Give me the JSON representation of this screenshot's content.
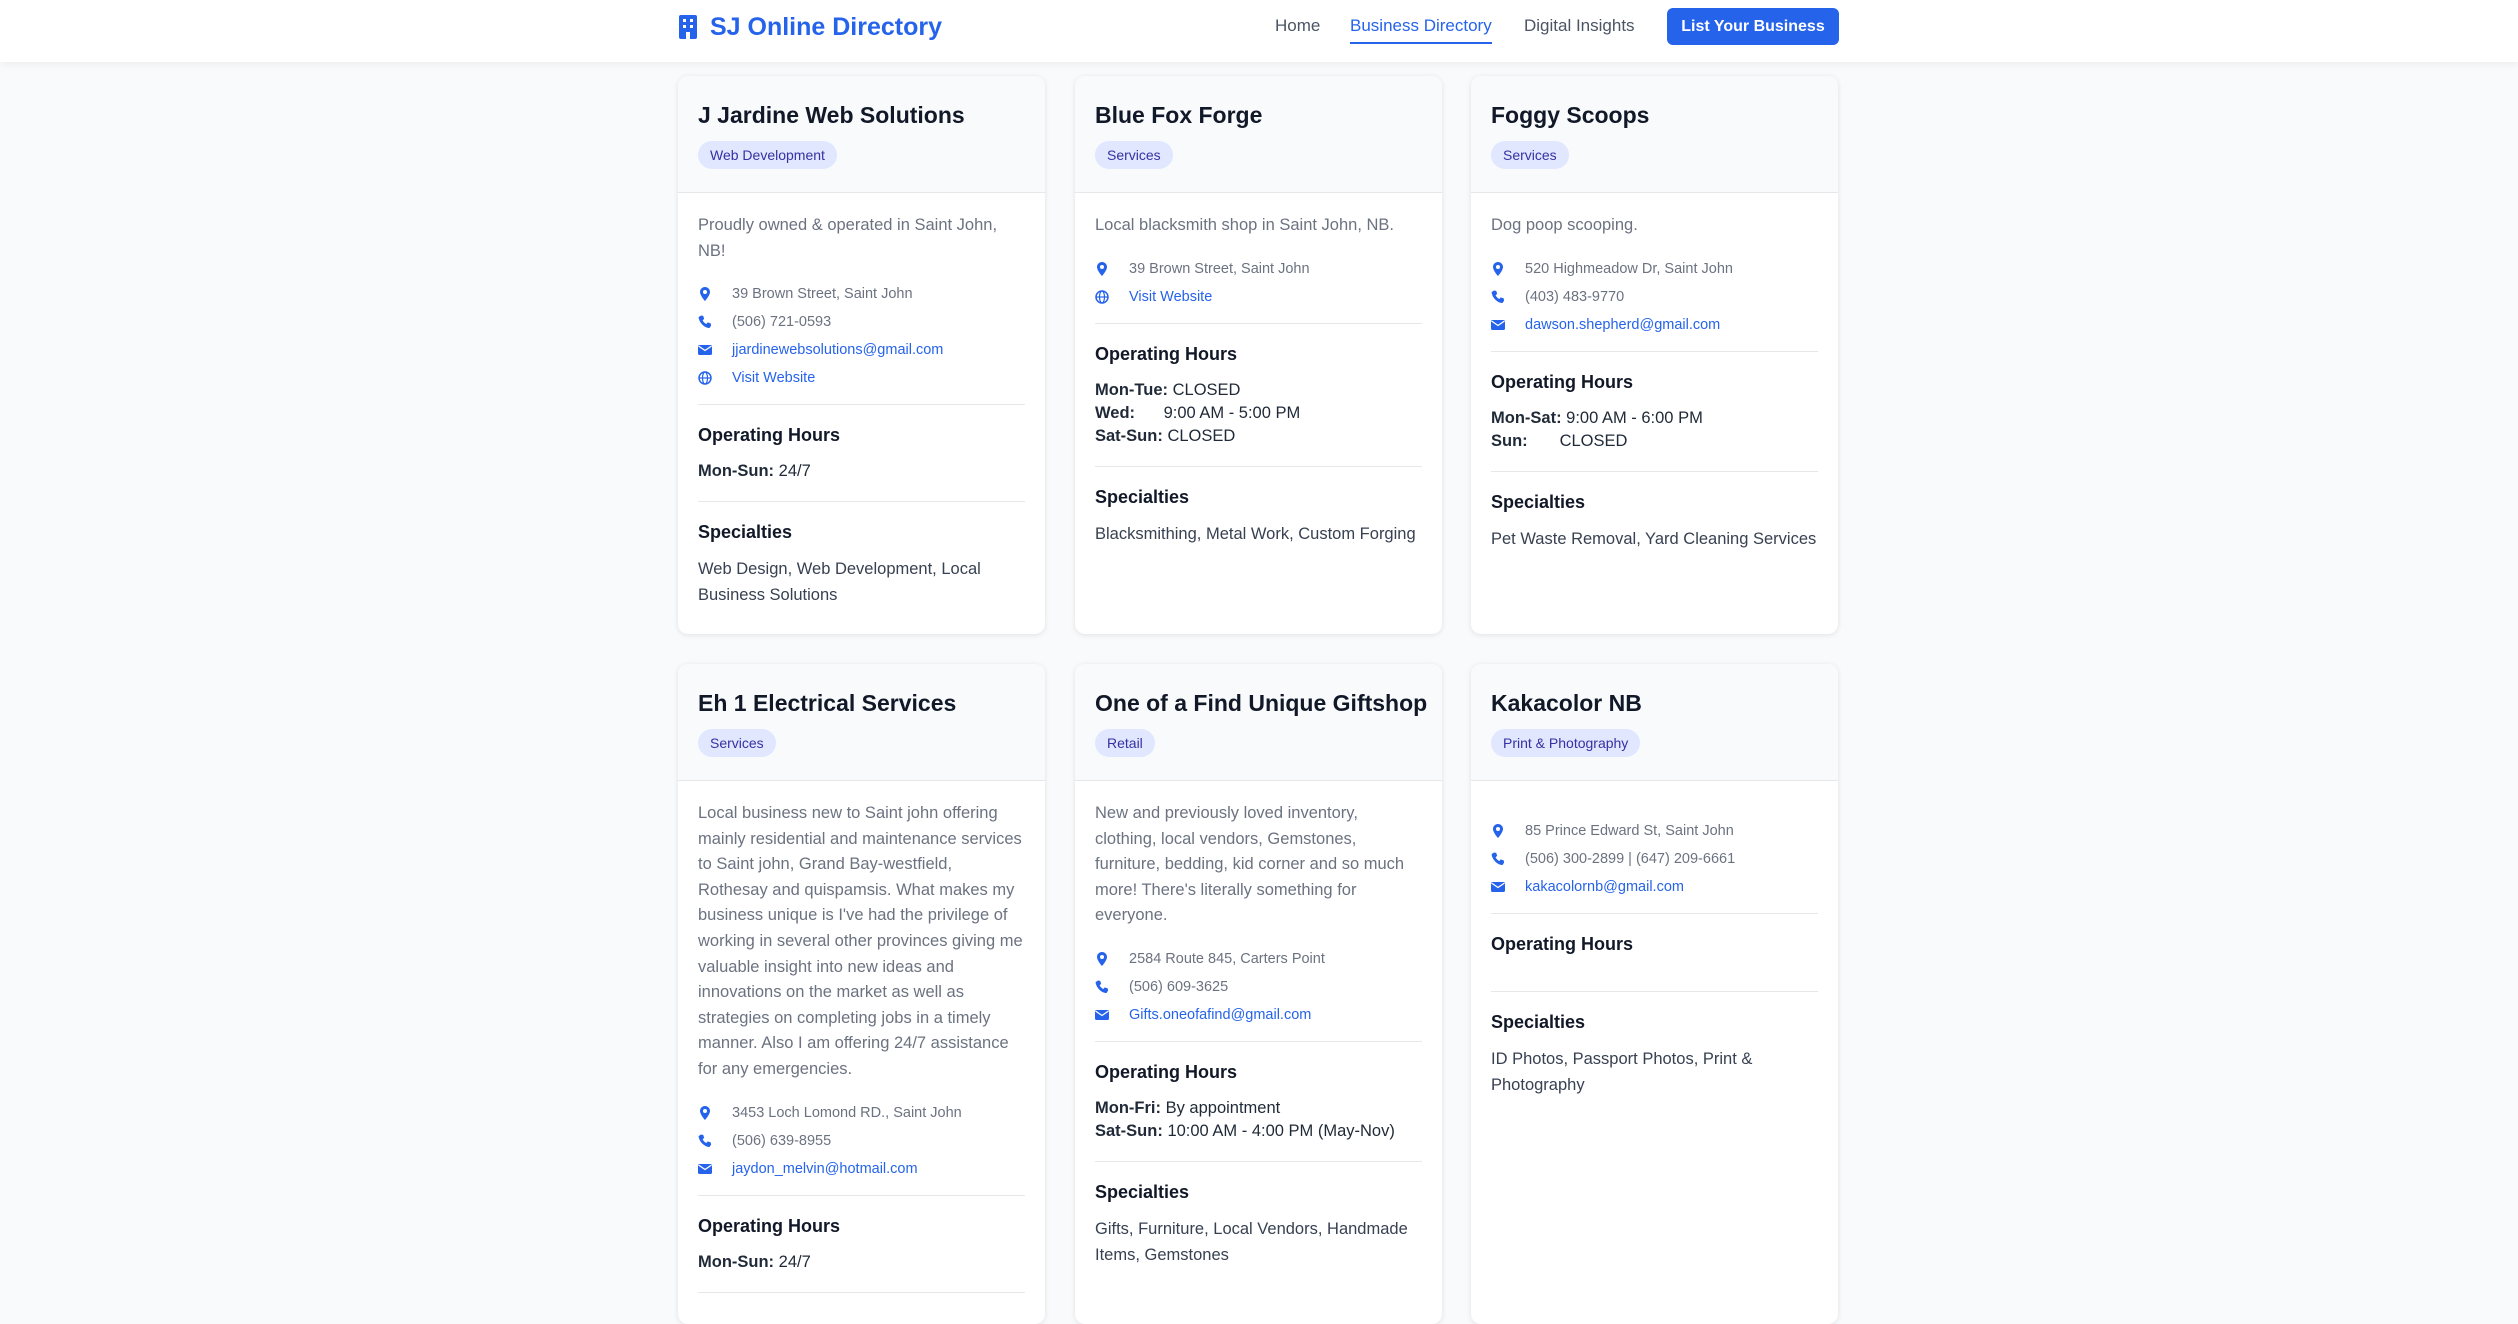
{
  "nav": {
    "brand": "SJ Online Directory",
    "brand_icon": "building-icon",
    "links": [
      "Home",
      "Business Directory",
      "Digital Insights"
    ],
    "active_link": "Business Directory",
    "cta": "List Your Business"
  },
  "colors": {
    "accent": "#2563eb",
    "badge_bg": "#e0e7ff",
    "badge_text": "#3730a3"
  },
  "labels": {
    "operating_hours": "Operating Hours",
    "specialties": "Specialties",
    "visit_website": "Visit Website"
  },
  "businesses": [
    {
      "name": "J Jardine Web Solutions",
      "category": "Web Development",
      "description": "Proudly owned & operated in Saint John, NB!",
      "address": "39 Brown Street, Saint John",
      "phone": "(506) 721-0593",
      "email": "jjardinewebsolutions@gmail.com",
      "website": "Visit Website",
      "hours": [
        {
          "days": "Mon-Sun:",
          "time": "24/7"
        }
      ],
      "specialties": "Web Design, Web Development, Local Business Solutions"
    },
    {
      "name": "Blue Fox Forge",
      "category": "Services",
      "description": "Local blacksmith shop in Saint John, NB.",
      "address": "39 Brown Street, Saint John",
      "website": "Visit Website",
      "hours": [
        {
          "days": "Mon-Tue:",
          "time": "CLOSED"
        },
        {
          "days": "Wed:",
          "time": "9:00 AM - 5:00 PM"
        },
        {
          "days": "Sat-Sun:",
          "time": "CLOSED"
        }
      ],
      "specialties": "Blacksmithing, Metal Work, Custom Forging"
    },
    {
      "name": "Foggy Scoops",
      "category": "Services",
      "description": "Dog poop scooping.",
      "address": "520 Highmeadow Dr, Saint John",
      "phone": "(403) 483-9770",
      "email": "dawson.shepherd@gmail.com",
      "hours": [
        {
          "days": "Mon-Sat:",
          "time": "9:00 AM - 6:00 PM"
        },
        {
          "days": "Sun:",
          "time": "CLOSED"
        }
      ],
      "specialties": "Pet Waste Removal, Yard Cleaning Services"
    },
    {
      "name": "Eh 1 Electrical Services",
      "category": "Services",
      "description": "Local business new to Saint john offering mainly residential and maintenance services to Saint john, Grand Bay-westfield, Rothesay and quispamsis. What makes my business unique is I've had the privilege of working in several other provinces giving me valuable insight into new ideas and innovations on the market as well as strategies on completing jobs in a timely manner. Also I am offering 24/7 assistance for any emergencies.",
      "address": "3453 Loch Lomond RD., Saint John",
      "phone": "(506) 639-8955",
      "email": "jaydon_melvin@hotmail.com",
      "hours": [
        {
          "days": "Mon-Sun:",
          "time": "24/7"
        }
      ],
      "specialties": ""
    },
    {
      "name": "One of a Find Unique Giftshop",
      "category": "Retail",
      "description": "New and previously loved inventory, clothing, local vendors, Gemstones, furniture, bedding, kid corner and so much more! There's literally something for everyone.",
      "address": "2584 Route 845, Carters Point",
      "phone": "(506) 609-3625",
      "email": "Gifts.oneofafind@gmail.com",
      "hours": [
        {
          "days": "Mon-Fri:",
          "time": "By appointment"
        },
        {
          "days": "Sat-Sun:",
          "time": "10:00 AM - 4:00 PM (May-Nov)"
        }
      ],
      "specialties": "Gifts, Furniture, Local Vendors, Handmade Items, Gemstones"
    },
    {
      "name": "Kakacolor NB",
      "category": "Print & Photography",
      "description": "",
      "address": "85 Prince Edward St, Saint John",
      "phone": "(506) 300-2899 | (647) 209-6661",
      "email": "kakacolornb@gmail.com",
      "hours": [],
      "specialties": "ID Photos, Passport Photos, Print & Photography"
    }
  ]
}
